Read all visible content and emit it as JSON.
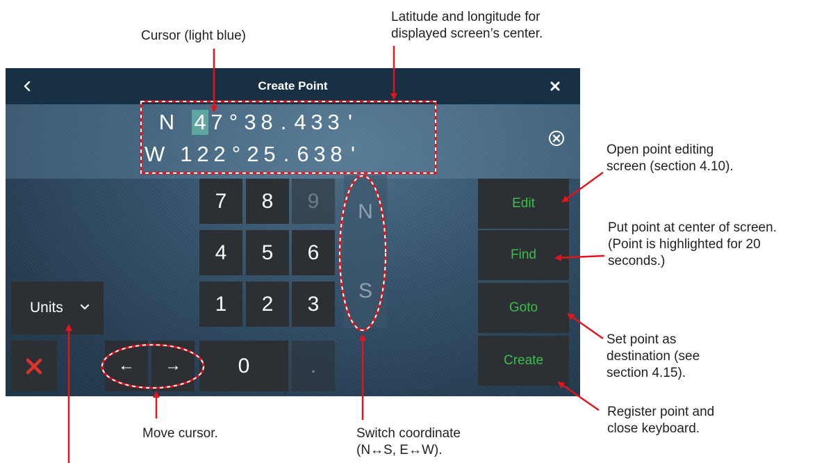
{
  "annotations": {
    "cursor": "Cursor (light blue)",
    "latlon_line1": "Latitude and longitude for",
    "latlon_line2": "displayed screen’s center.",
    "edit_line1": "Open point editing",
    "edit_line2": "screen (section 4.10).",
    "find_line1": "Put point at center of screen.",
    "find_line2": "(Point is highlighted for 20",
    "find_line3": "seconds.)",
    "goto_line1": "Set point as",
    "goto_line2": "destination (see",
    "goto_line3": "section 4.15).",
    "create_line1": "Register point and",
    "create_line2": "close keyboard.",
    "move_cursor": "Move cursor.",
    "switch_line1": "Switch coordinate",
    "switch_line2": "(N↔S, E↔W)."
  },
  "dialog": {
    "title": "Create Point",
    "back_icon": "chevron-left-icon",
    "close_icon": "close-icon"
  },
  "coordinates": {
    "latitude_chars": [
      "N",
      " ",
      "4",
      "7",
      "°",
      "3",
      "8",
      ".",
      "4",
      "3",
      "3",
      "'"
    ],
    "longitude_chars": [
      "W",
      " ",
      "1",
      "2",
      "2",
      "°",
      "2",
      "5",
      ".",
      "6",
      "3",
      "8",
      "'"
    ],
    "cursor_index": 2,
    "clear_icon": "clear-circle-icon"
  },
  "keypad": {
    "row1": [
      "7",
      "8",
      "9"
    ],
    "row2": [
      "4",
      "5",
      "6"
    ],
    "row3": [
      "1",
      "2",
      "3"
    ],
    "zero": "0",
    "dot": ".",
    "hemisphere": [
      "N",
      "S"
    ]
  },
  "controls": {
    "units_label": "Units",
    "left_arrow": "←",
    "right_arrow": "→",
    "cancel_icon": "red-x-icon"
  },
  "commands": {
    "edit": "Edit",
    "find": "Find",
    "goto": "Goto",
    "create": "Create"
  },
  "colors": {
    "title_bar": "#173043",
    "key_bg": "#2c2f33",
    "command_text": "#3bbf4b",
    "cursor_highlight": "#5fa6a0",
    "annotation_arrow": "#e3141b",
    "cancel_x": "#d9342b"
  }
}
